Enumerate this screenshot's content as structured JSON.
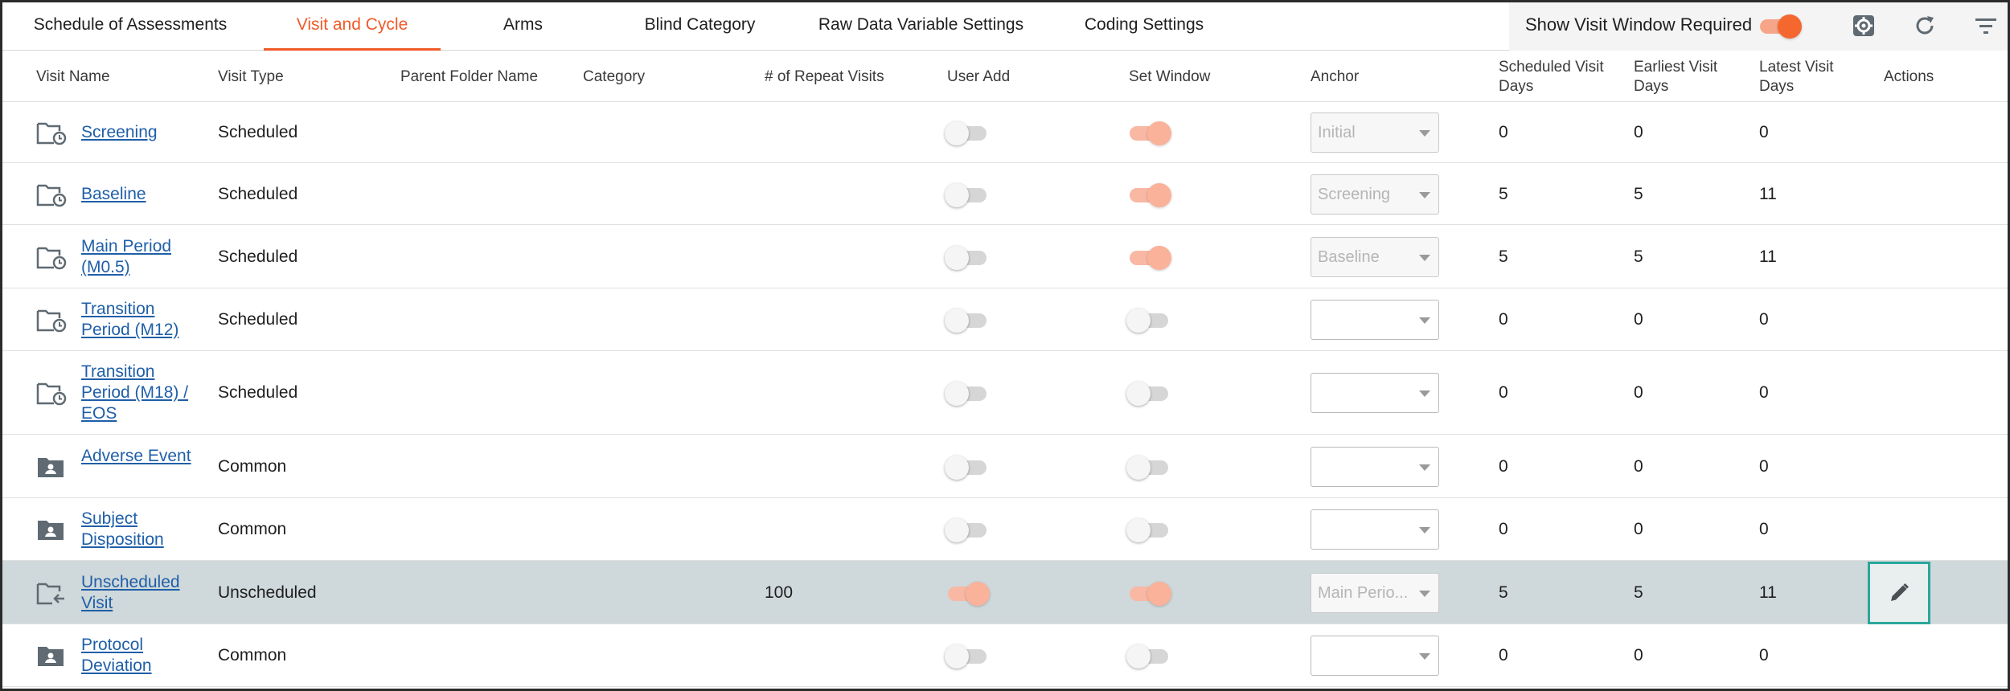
{
  "tabs": [
    {
      "label": "Schedule of Assessments",
      "active": false
    },
    {
      "label": "Visit and Cycle",
      "active": true
    },
    {
      "label": "Arms",
      "active": false
    },
    {
      "label": "Blind Category",
      "active": false
    },
    {
      "label": "Raw Data Variable Settings",
      "active": false
    },
    {
      "label": "Coding Settings",
      "active": false
    }
  ],
  "toolbar": {
    "show_window_label": "Show Visit Window Required",
    "show_window_on": true,
    "settings_icon": "settings-gear-icon",
    "refresh_icon": "refresh-icon",
    "filter_icon": "filter-icon"
  },
  "columns": {
    "visit_name": "Visit Name",
    "visit_type": "Visit Type",
    "parent_folder": "Parent Folder Name",
    "category": "Category",
    "repeat_visits": "# of Repeat Visits",
    "user_add": "User Add",
    "set_window": "Set Window",
    "anchor": "Anchor",
    "scheduled_days": "Scheduled Visit Days",
    "earliest_days": "Earliest Visit Days",
    "latest_days": "Latest Visit Days",
    "actions": "Actions"
  },
  "rows": [
    {
      "name": "Screening",
      "type": "Scheduled",
      "repeat": "",
      "user_add": false,
      "set_window": true,
      "anchor": "Initial",
      "scheduled": "0",
      "earliest": "0",
      "latest": "0",
      "icon": "folder-clock-icon"
    },
    {
      "name": "Baseline",
      "type": "Scheduled",
      "repeat": "",
      "user_add": false,
      "set_window": true,
      "anchor": "Screening",
      "scheduled": "5",
      "earliest": "5",
      "latest": "11",
      "icon": "folder-clock-icon"
    },
    {
      "name": "Main Period (M0.5)",
      "type": "Scheduled",
      "repeat": "",
      "user_add": false,
      "set_window": true,
      "anchor": "Baseline",
      "scheduled": "5",
      "earliest": "5",
      "latest": "11",
      "icon": "folder-clock-icon"
    },
    {
      "name": "Transition Period (M12)",
      "type": "Scheduled",
      "repeat": "",
      "user_add": false,
      "set_window": false,
      "anchor": "",
      "scheduled": "0",
      "earliest": "0",
      "latest": "0",
      "icon": "folder-clock-icon"
    },
    {
      "name": "Transition Period (M18) / EOS",
      "type": "Scheduled",
      "repeat": "",
      "user_add": false,
      "set_window": false,
      "anchor": "",
      "scheduled": "0",
      "earliest": "0",
      "latest": "0",
      "icon": "folder-clock-icon"
    },
    {
      "name": "Adverse Event",
      "type": "Common",
      "repeat": "",
      "user_add": false,
      "set_window": false,
      "anchor": "",
      "scheduled": "0",
      "earliest": "0",
      "latest": "0",
      "icon": "folder-person-icon"
    },
    {
      "name": "Subject Disposition",
      "type": "Common",
      "repeat": "",
      "user_add": false,
      "set_window": false,
      "anchor": "",
      "scheduled": "0",
      "earliest": "0",
      "latest": "0",
      "icon": "folder-person-icon"
    },
    {
      "name": "Unscheduled Visit",
      "type": "Unscheduled",
      "repeat": "100",
      "user_add": true,
      "set_window": true,
      "anchor": "Main Perio...",
      "scheduled": "5",
      "earliest": "5",
      "latest": "11",
      "icon": "folder-arrow-icon",
      "selected": true,
      "edit_icon": "pencil-icon"
    },
    {
      "name": "Protocol Deviation",
      "type": "Common",
      "repeat": "",
      "user_add": false,
      "set_window": false,
      "anchor": "",
      "scheduled": "0",
      "earliest": "0",
      "latest": "0",
      "icon": "folder-person-icon"
    }
  ],
  "colors": {
    "accent": "#f05a28",
    "link": "#1f5fa8",
    "selected_row": "#cfd8da",
    "edit_border": "#2aa79b"
  }
}
